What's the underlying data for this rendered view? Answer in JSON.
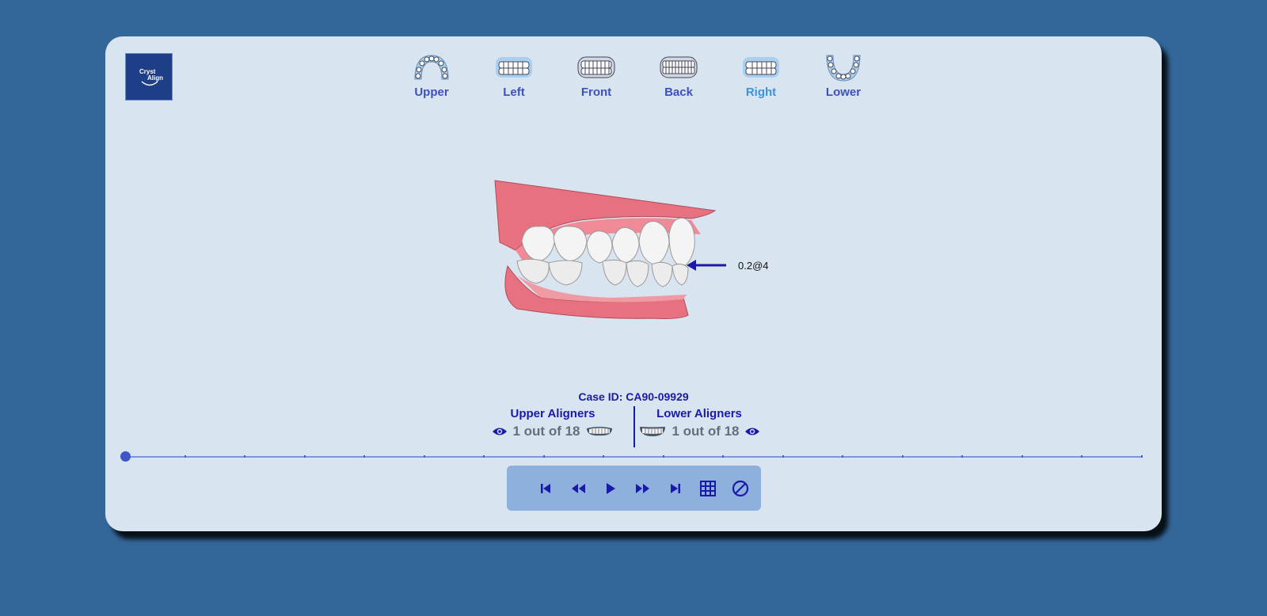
{
  "logo": {
    "line1": "Cryst",
    "line2": "Align"
  },
  "views": [
    {
      "label": "Upper",
      "icon": "upper-arch-icon"
    },
    {
      "label": "Left",
      "icon": "left-view-icon"
    },
    {
      "label": "Front",
      "icon": "front-view-icon"
    },
    {
      "label": "Back",
      "icon": "back-view-icon"
    },
    {
      "label": "Right",
      "icon": "right-view-icon",
      "active": true
    },
    {
      "label": "Lower",
      "icon": "lower-arch-icon"
    }
  ],
  "measurement": "0.2@4",
  "case": {
    "label": "Case ID: CA90-09929"
  },
  "upper": {
    "title": "Upper Aligners",
    "count": "1 out of 18"
  },
  "lower": {
    "title": "Lower Aligners",
    "count": "1 out of 18"
  },
  "timeline": {
    "steps": 18,
    "current": 1
  },
  "controls": [
    "first-step-icon",
    "rewind-icon",
    "play-icon",
    "fast-forward-icon",
    "last-step-icon",
    "grid-icon",
    "no-attachments-icon"
  ],
  "colors": {
    "background": "#336699",
    "panel": "#d9e4f1",
    "accent": "#1a1aa8",
    "active_view": "#3b94db",
    "gum": "#e8717f"
  }
}
